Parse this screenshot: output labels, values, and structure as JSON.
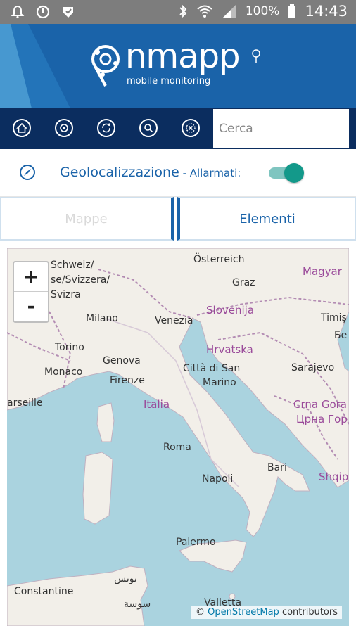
{
  "status_bar": {
    "battery": "100%",
    "time": "14:43"
  },
  "header": {
    "logo_word": "nmapp",
    "logo_sub": "mobile monitoring"
  },
  "toolbar": {
    "buttons": [
      "home-icon",
      "target-icon",
      "refresh-icon",
      "search-icon",
      "close-icon"
    ],
    "search_placeholder": "Cerca"
  },
  "geo": {
    "title": "Geolocalizzazione",
    "subtitle": " - Allarmati:",
    "toggle_on": true
  },
  "tabs": {
    "mappe": "Mappe",
    "elementi": "Elementi"
  },
  "map": {
    "zoom_in": "+",
    "zoom_out": "-",
    "labels": {
      "schweiz1": "Schweiz/",
      "schweiz2": "se/Svizzera/",
      "schweiz3": "Svizra",
      "osterreich": "Österreich",
      "magyar": "Magyar",
      "graz": "Graz",
      "slovenija": "Slovenija",
      "milano": "Milano",
      "venezia": "Venezia",
      "timis": "Timiș",
      "torino": "Torino",
      "hrvatska": "Hrvatska",
      "genova": "Genova",
      "monaco": "Monaco",
      "firenze": "Firenze",
      "sanmarino1": "Città di San",
      "sanmarino2": "Marino",
      "sarajevo": "Sarajevo",
      "marseille": "arseille",
      "italia": "Italia",
      "crnagora1": "Crna Gora",
      "crnagora2": "Црна Гор",
      "roma": "Roma",
      "bari": "Bari",
      "napoli": "Napoli",
      "shqip": "Shqip",
      "palermo": "Palermo",
      "tunis": "تونس",
      "constantine": "Constantine",
      "sousse": "سوسة",
      "valletta": "Valletta",
      "be": "Бе"
    },
    "attribution_prefix": "© ",
    "attribution_link": "OpenStreetMap",
    "attribution_suffix": " contributors"
  }
}
